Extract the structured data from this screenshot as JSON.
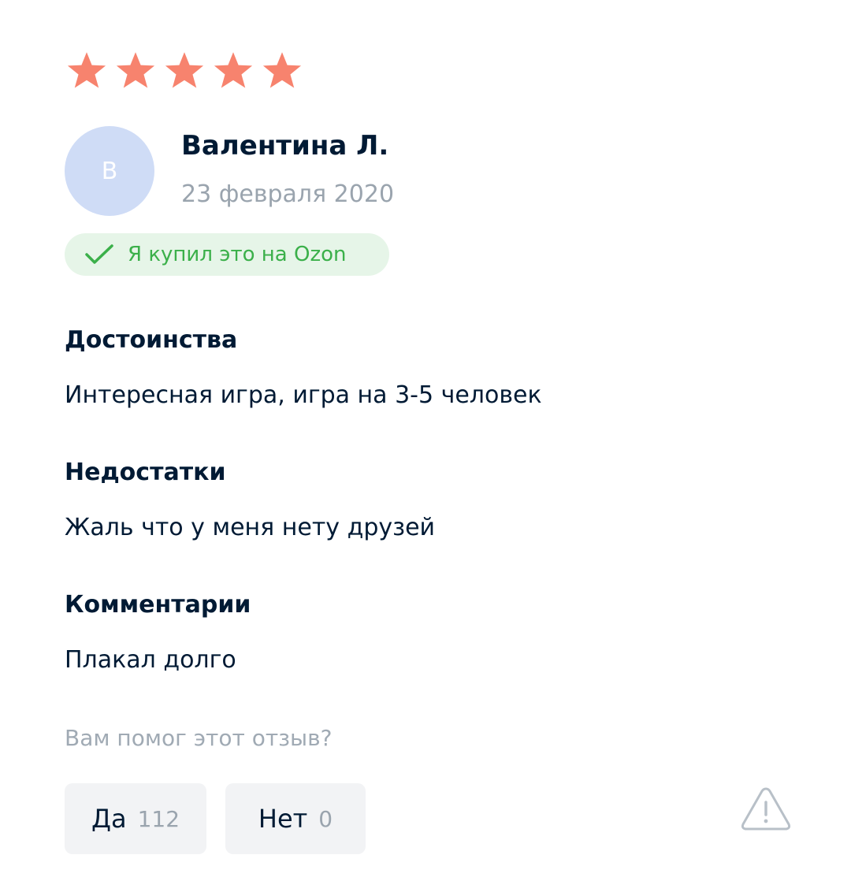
{
  "rating": {
    "value": 5,
    "max": 5,
    "star_color": "#f7836e"
  },
  "author": {
    "initial": "В",
    "name": "Валентина Л.",
    "date": "23 февраля 2020",
    "avatar_color": "#cfdcf6"
  },
  "verified": {
    "label": "Я купил это на Ozon",
    "icon": "checkmark-icon",
    "color": "#3bb04a"
  },
  "sections": [
    {
      "title": "Достоинства",
      "text": "Интересная игра, игра на 3-5 человек"
    },
    {
      "title": "Недостатки",
      "text": "Жаль что у меня нету друзей"
    },
    {
      "title": "Комментарии",
      "text": "Плакал долго"
    }
  ],
  "helpful": {
    "question": "Вам помог этот отзыв?",
    "yes_label": "Да",
    "yes_count": "112",
    "no_label": "Нет",
    "no_count": "0",
    "report_icon": "warning-triangle-icon"
  }
}
